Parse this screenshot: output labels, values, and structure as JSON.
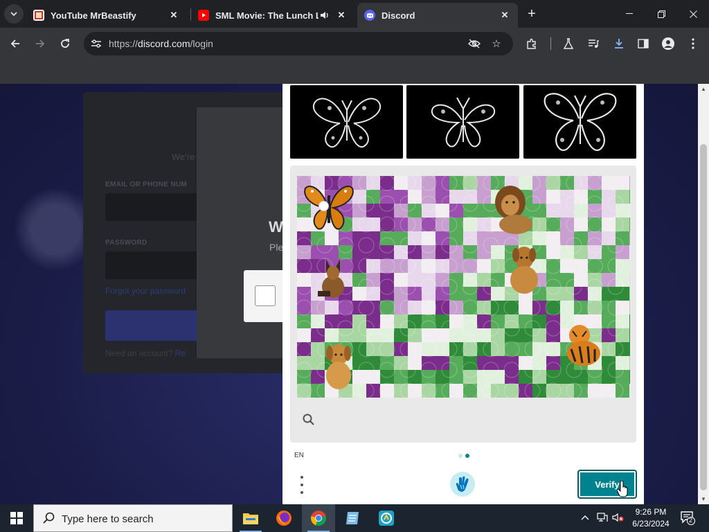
{
  "browser": {
    "tabs": [
      {
        "title": "YouTube MrBeastify",
        "active": false
      },
      {
        "title": "SML Movie: The Lunch Lad",
        "active": false,
        "audio": true
      },
      {
        "title": "Discord",
        "active": true
      }
    ],
    "address": {
      "scheme": "https://",
      "host": "discord.com",
      "path": "/login"
    }
  },
  "login_form": {
    "subtitle": "We're",
    "email_label": "EMAIL OR PHONE NUM",
    "password_label": "PASSWORD",
    "forgot": "Forgot your password",
    "need_account": "Need an account?",
    "register": "Re"
  },
  "modal": {
    "heading": "W",
    "subtext": "Ple"
  },
  "captcha": {
    "example_count": 3,
    "example_subject": "butterfly",
    "animals": [
      "butterfly",
      "lion",
      "dog",
      "german-shepherd",
      "golden-retriever",
      "tiger",
      "puppy"
    ],
    "language": "EN",
    "verify_label": "Verify",
    "page_dots": 2,
    "active_dot": 2,
    "colors": {
      "accent": "#00838f",
      "panel": "#e9e9ea"
    }
  },
  "taskbar": {
    "search_placeholder": "Type here to search",
    "time": "9:26 PM",
    "date": "6/23/2024",
    "notification_count": "2"
  }
}
